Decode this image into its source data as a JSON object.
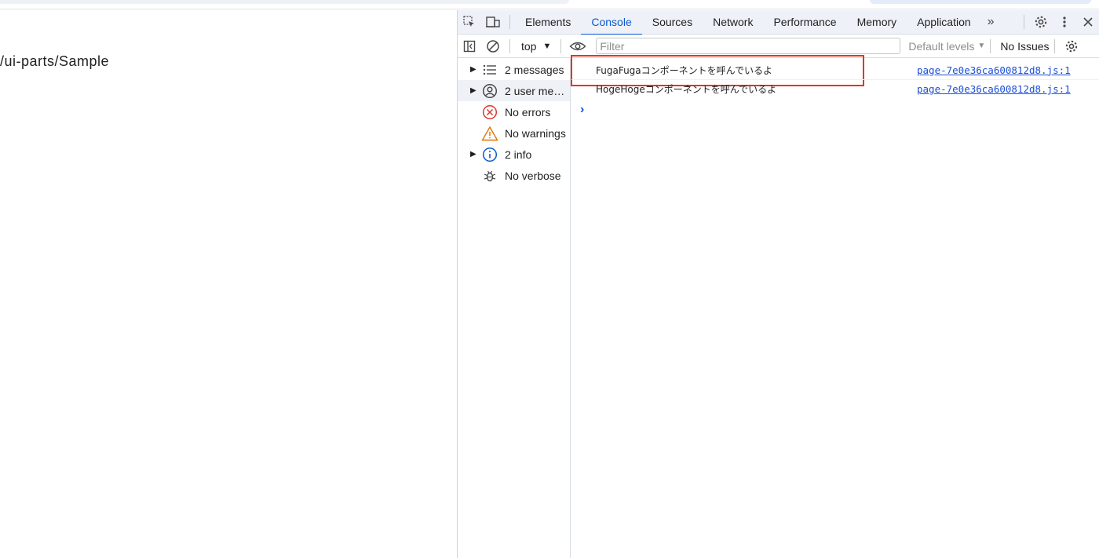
{
  "page": {
    "path": "/ui-parts/Sample"
  },
  "devtools": {
    "tabs": [
      {
        "label": "Elements",
        "active": false
      },
      {
        "label": "Console",
        "active": true
      },
      {
        "label": "Sources",
        "active": false
      },
      {
        "label": "Network",
        "active": false
      },
      {
        "label": "Performance",
        "active": false
      },
      {
        "label": "Memory",
        "active": false
      },
      {
        "label": "Application",
        "active": false
      }
    ],
    "more_tabs": "»",
    "toolbar": {
      "context": "top",
      "filter_placeholder": "Filter",
      "levels": "Default levels",
      "issues": "No Issues"
    },
    "sidebar": [
      {
        "label": "2 messages",
        "icon": "list-icon",
        "expandable": true,
        "selected": false
      },
      {
        "label": "2 user me…",
        "icon": "user-icon",
        "expandable": true,
        "selected": true
      },
      {
        "label": "No errors",
        "icon": "error-icon",
        "expandable": false,
        "selected": false
      },
      {
        "label": "No warnings",
        "icon": "warning-icon",
        "expandable": false,
        "selected": false
      },
      {
        "label": "2 info",
        "icon": "info-icon",
        "expandable": true,
        "selected": false
      },
      {
        "label": "No verbose",
        "icon": "bug-icon",
        "expandable": false,
        "selected": false
      }
    ],
    "messages": [
      {
        "text": "FugaFugaコンポーネントを呼んでいるよ",
        "source": "page-7e0e36ca600812d8.js:1",
        "highlighted": true
      },
      {
        "text": "HogeHogeコンポーネントを呼んでいるよ",
        "source": "page-7e0e36ca600812d8.js:1",
        "highlighted": false
      }
    ],
    "colors": {
      "accent": "#0b57d0",
      "highlight": "#e53323",
      "error": "#dc362e",
      "warning": "#e37400",
      "link": "#1a4fd6"
    }
  }
}
